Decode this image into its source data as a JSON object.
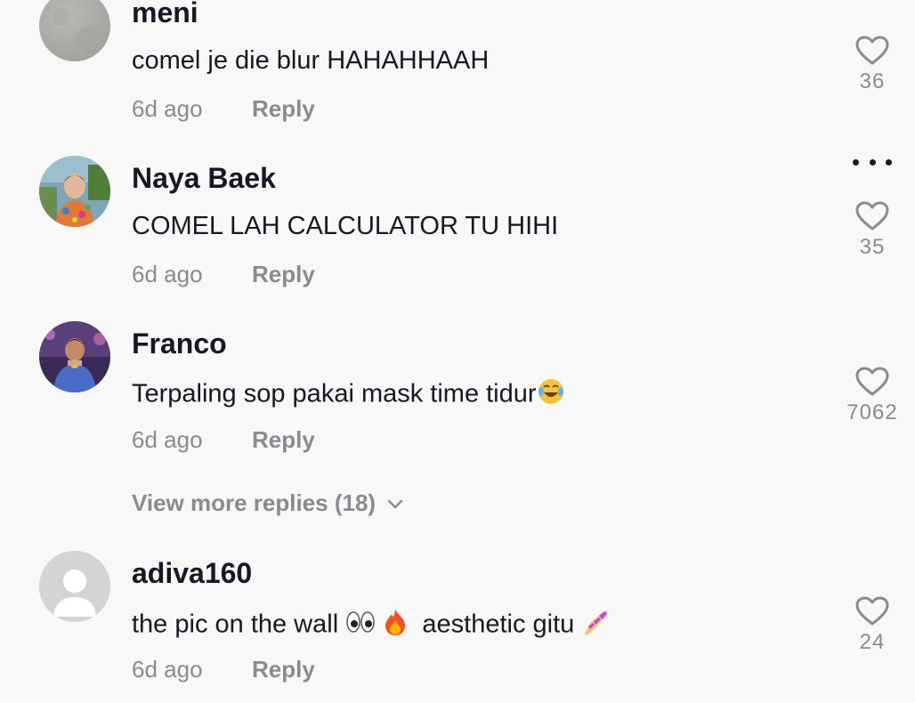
{
  "comments": [
    {
      "username": "meni",
      "text": "comel je die blur HAHAHHAAH",
      "time": "6d ago",
      "reply_label": "Reply",
      "likes": "36",
      "avatar": "grey-textured"
    },
    {
      "username": "Naya Baek",
      "text": "COMEL LAH CALCULATOR TU HIHI",
      "time": "6d ago",
      "reply_label": "Reply",
      "likes": "35",
      "avatar": "photo-person"
    },
    {
      "username": "Franco",
      "text": "Terpaling sop pakai mask time tidur",
      "text_emoji": "tears-of-joy-emoji",
      "time": "6d ago",
      "reply_label": "Reply",
      "likes": "7062",
      "avatar": "photo-person"
    },
    {
      "username": "adiva160",
      "text_part1": "the pic on the wall",
      "text_part2": "aesthetic gitu",
      "text_emojis": [
        "eyes-emoji",
        "fire-emoji",
        "nail-polish-emoji"
      ],
      "time": "6d ago",
      "reply_label": "Reply",
      "likes": "24",
      "avatar": "default-placeholder"
    }
  ],
  "view_more_replies": "View more replies (18)",
  "icons": {
    "like": "heart-outline-icon",
    "more": "more-options-icon",
    "expand": "chevron-down-icon"
  },
  "colors": {
    "background": "#f8f8f8",
    "primary_text": "#161823",
    "secondary_text": "#8a8b91"
  }
}
